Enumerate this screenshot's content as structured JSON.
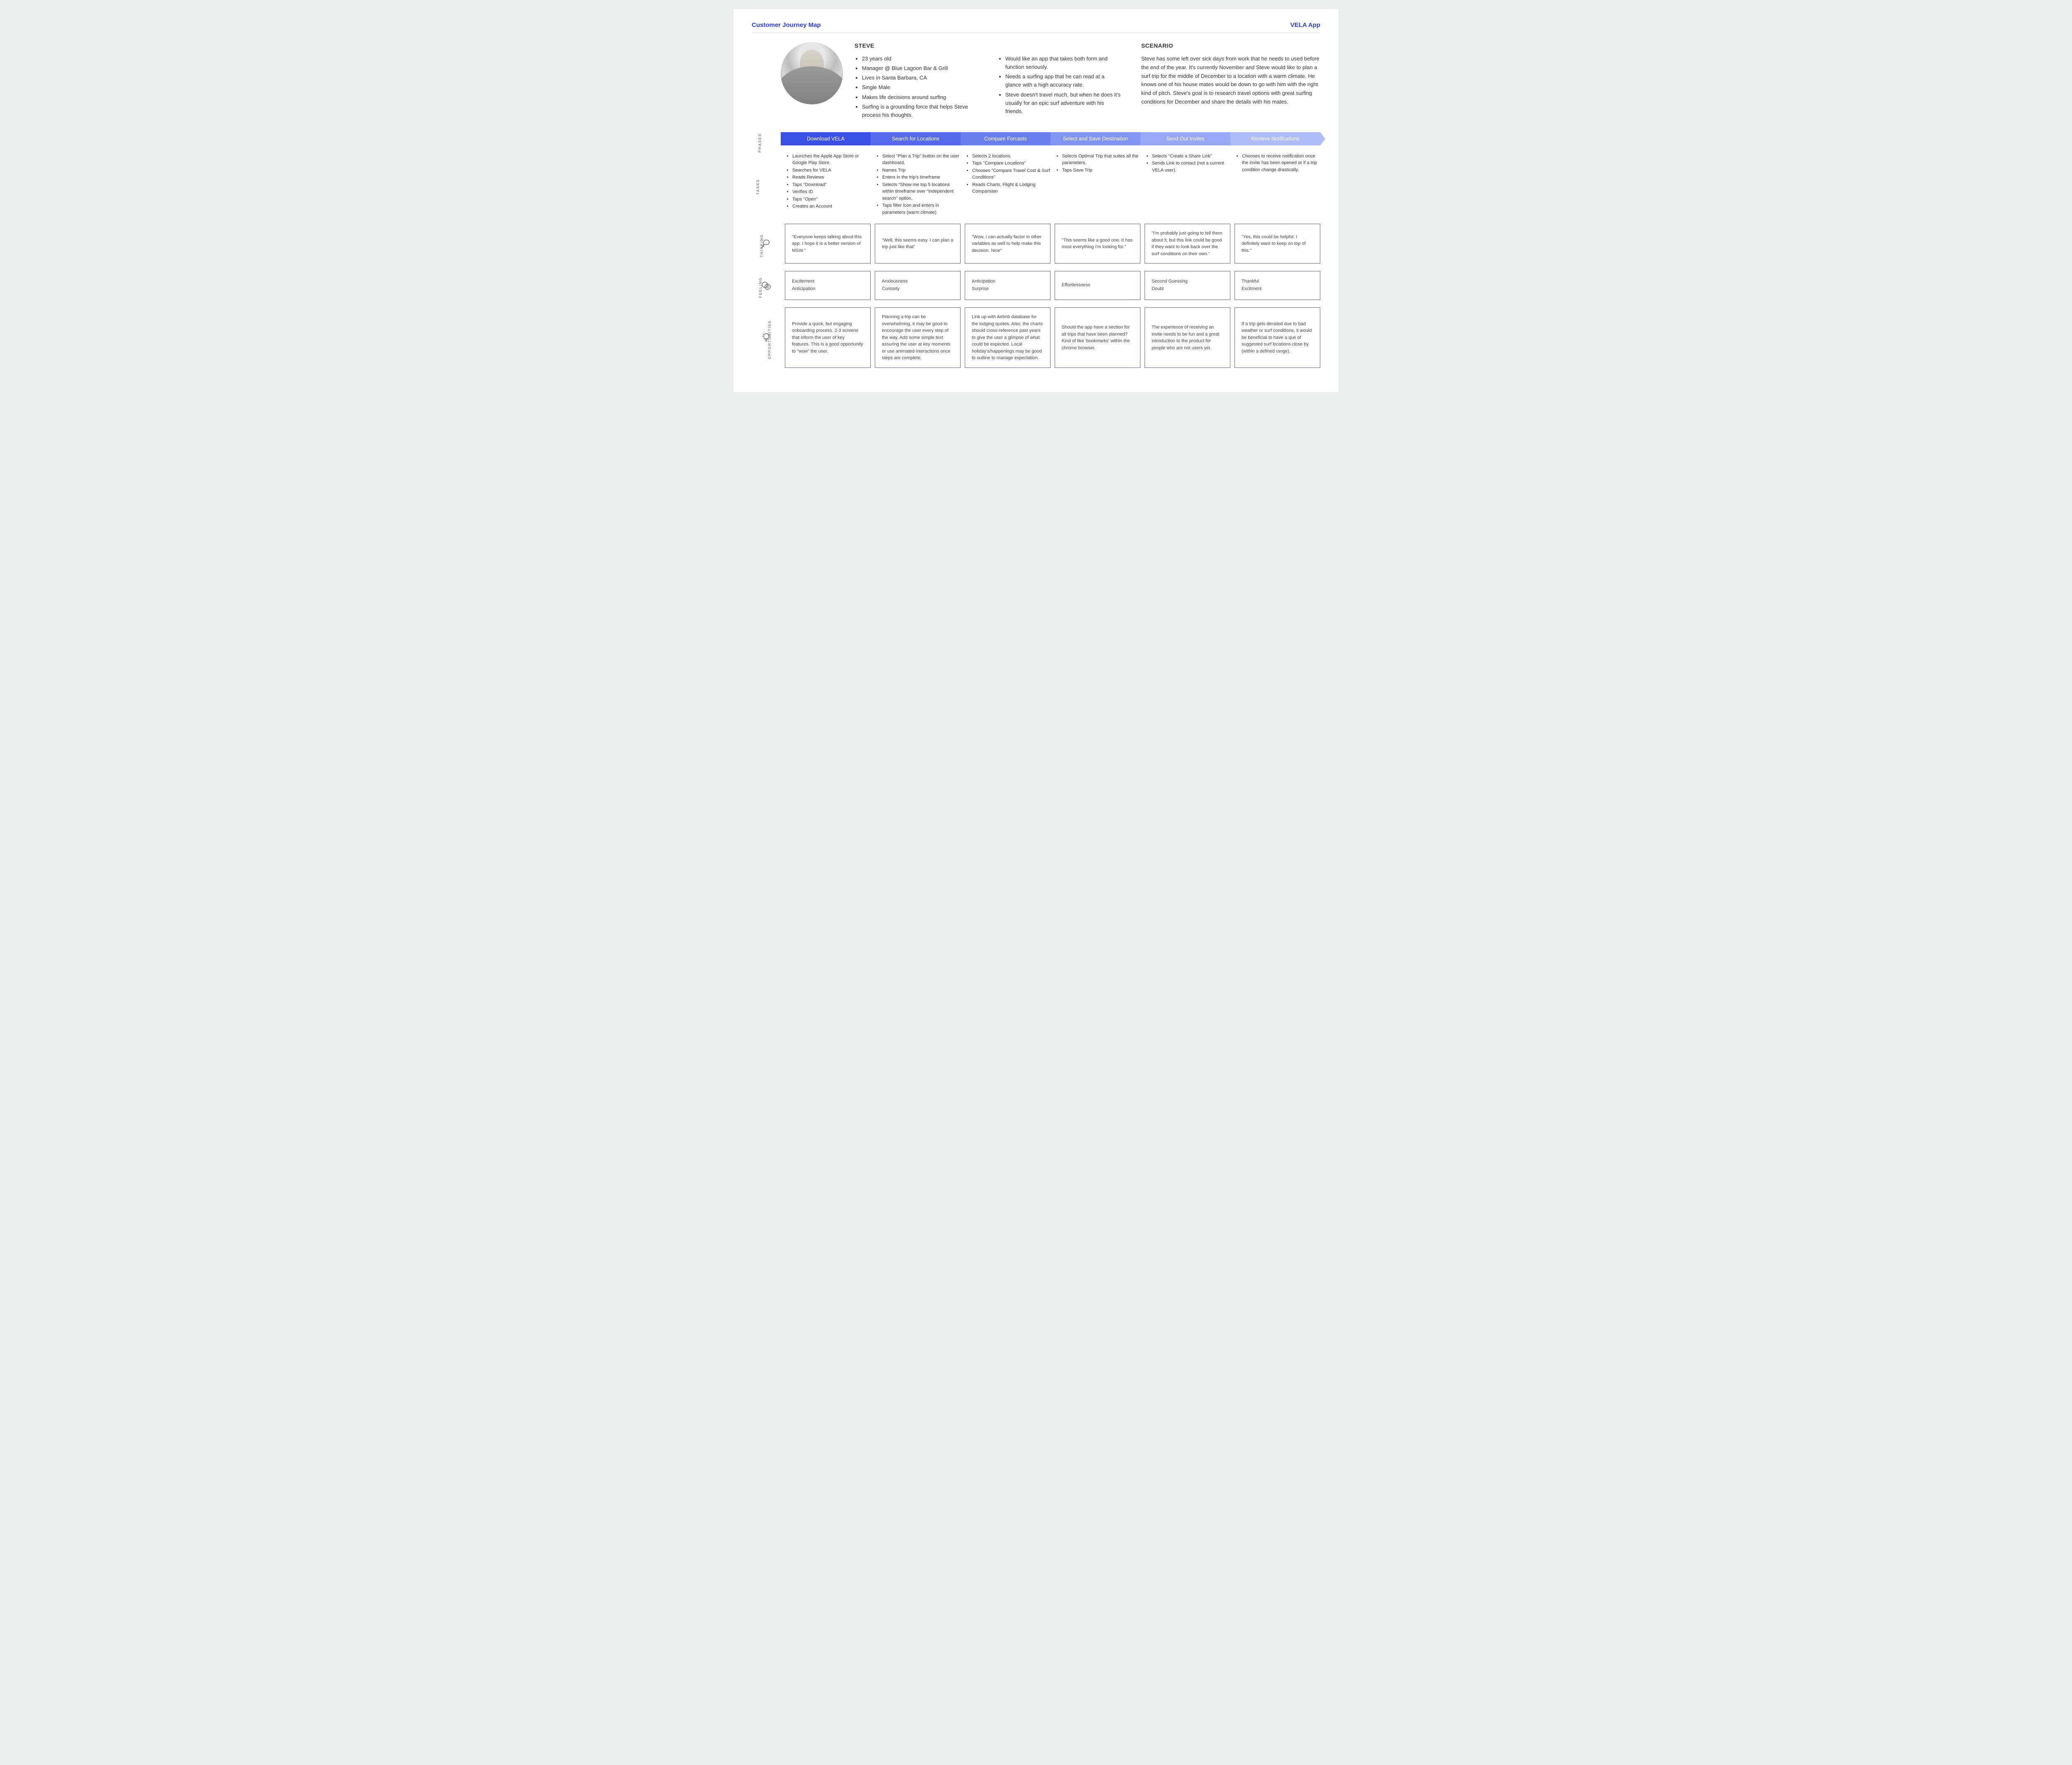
{
  "header": {
    "title_left": "Customer Journey Map",
    "title_right": "VELA App"
  },
  "persona": {
    "name": "STEVE",
    "bullets_a": [
      "23 years old",
      "Manager @ Blue Lagoon Bar & Grill",
      "Lives in Santa Barbara, CA",
      "Single Male",
      "Makes life decisions around surfing",
      "Surfing is a grounding force that helps Steve process his thoughts."
    ],
    "bullets_b": [
      "Would like an app that takes both form and function seriously.",
      "Needs a surfing app that he can read at a glance with a high accuracy rate.",
      "Steve doesn't travel much, but when he does it's usually for an epic surf adventure with his friends."
    ],
    "scenario_h": "SCENARIO",
    "scenario_body": "Steve has some left over sick days from work that he needs to used before the end of the year. It's currently November and Steve would like to plan a surf trip for the middle of December to a location with a warm climate. He knows one of his house mates would be down to go with him with the right kind of pitch. Steve's goal is to research travel options with great surfing conditions for December and share the details with his mates."
  },
  "labels": {
    "phases": "PHASES",
    "tasks": "TASKS",
    "thinking": "THINKING",
    "feeling": "FEELING",
    "opportunities": "OPPORTUNITIES"
  },
  "phases": [
    "Download VELA",
    "Search for Locations",
    "Compare Forcasts",
    "Select and Save Destination",
    "Send Out Invites",
    "Recieve Notifications"
  ],
  "tasks": [
    [
      "Launches the Apple App Store or Google Play Store.",
      "Searches for VELA",
      "Reads Reviews",
      "Taps \"Download\"",
      "Verifies ID",
      "Taps \"Open\"",
      "Creates an Account"
    ],
    [
      "Select \"Plan a Trip\" button on the user dashboard.",
      "Names Trip",
      "Enters in the trip's timeframe",
      "Selects \"Show me top 5 locations within timeframe over \"independent search\" option.",
      "Taps filter icon and enters in parameters (warm climate)"
    ],
    [
      "Selects 2 locations.",
      "Taps \"Compare Locations\"",
      "Chooses \"Compare Travel Cost & Surf Conditions\"",
      "Reads Charts, Flight & Lodging Comparision"
    ],
    [
      "Selects Optimal Trip that suites all the parameters.",
      "Taps Save Trip"
    ],
    [
      "Selects \"Create a Share Link\"",
      "Sends Link to contact (not a current VELA user)."
    ],
    [
      "Chooses to receive notification once the invite has been opened or if a trip condition change drastically."
    ]
  ],
  "thinking": [
    "\"Everyone keeps talking about this app. I hope it is a better version of MSW.\"",
    "\"Well, this seems easy. I can plan a trip just like that\"",
    "\"Wow, I can actually factor in other variables as well to help make this decision. Nice\"",
    "\"This seems like a good one. It has most everything I'm looking for.\"",
    "\"I'm probably just going to tell them about it, but this link could be good if they want to look back over the surf conditions on their own.\"",
    "\"Yes, this could be helpful. I definitely want to keep on top of this.\""
  ],
  "feeling": [
    [
      "Excitement",
      "Anticipation"
    ],
    [
      "Anxiousness",
      "Curiosity"
    ],
    [
      "Anticipation",
      "Surprise"
    ],
    [
      "Effortlessness"
    ],
    [
      "Second Guessing",
      "Doubt"
    ],
    [
      "Thankful",
      "Excitment"
    ]
  ],
  "opportunities": [
    "Provide a quick, but engaging onboarding process. 2-3 screens that inform the user of key features. This is a good opportunity to \"wow\" the user.",
    "Planning a trip can be overwhelming, it may be good to encourage the user every step of the way. Add some simple text assuring the user at key moments or use animated interactions once steps are complete.",
    "Link up with Airbnb database for the lodging quotes. Also, the charts should cross-reference past years to give the user a glimpse of what could be expected. Local holiday's/happenings may be good to outline to manage expectation.",
    "Should the app have a section for all trips that have been planned? Kind of like 'bookmarks' within the chrome browser.",
    "The experience of receiving an invite needs to be fun and a great introduction to the product for people who are not users yet.",
    "If a trip gets derailed due to bad weather or surf conditions, it would be beneficial to have a que of suggested surf locations close by (within a defined range)."
  ]
}
